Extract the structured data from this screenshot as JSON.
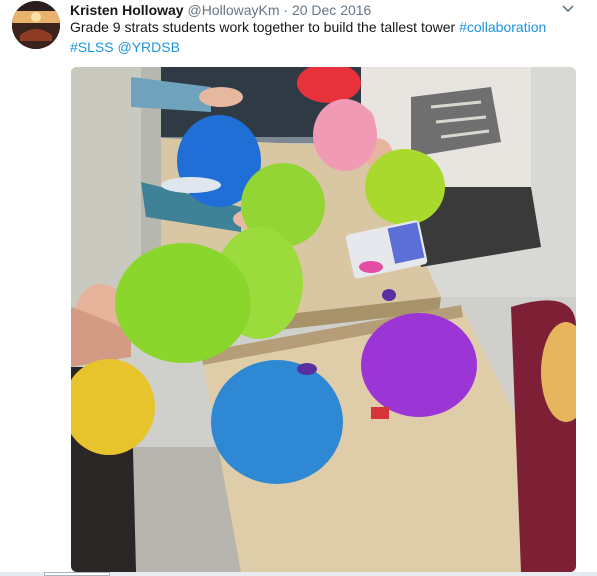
{
  "tweet": {
    "author_name": "Kristen Holloway",
    "author_handle": "@HollowayKm",
    "separator": "·",
    "date": "20 Dec 2016",
    "text_main": "Grade 9 strats students work together to build the tallest tower",
    "hashtags": [
      "#collaboration",
      "#SLSS"
    ],
    "mention": "@YRDSB",
    "menu_icon": "chevron-down-icon"
  },
  "colors": {
    "link": "#1b95e0",
    "secondary_text": "#657786",
    "primary_text": "#14171a"
  }
}
